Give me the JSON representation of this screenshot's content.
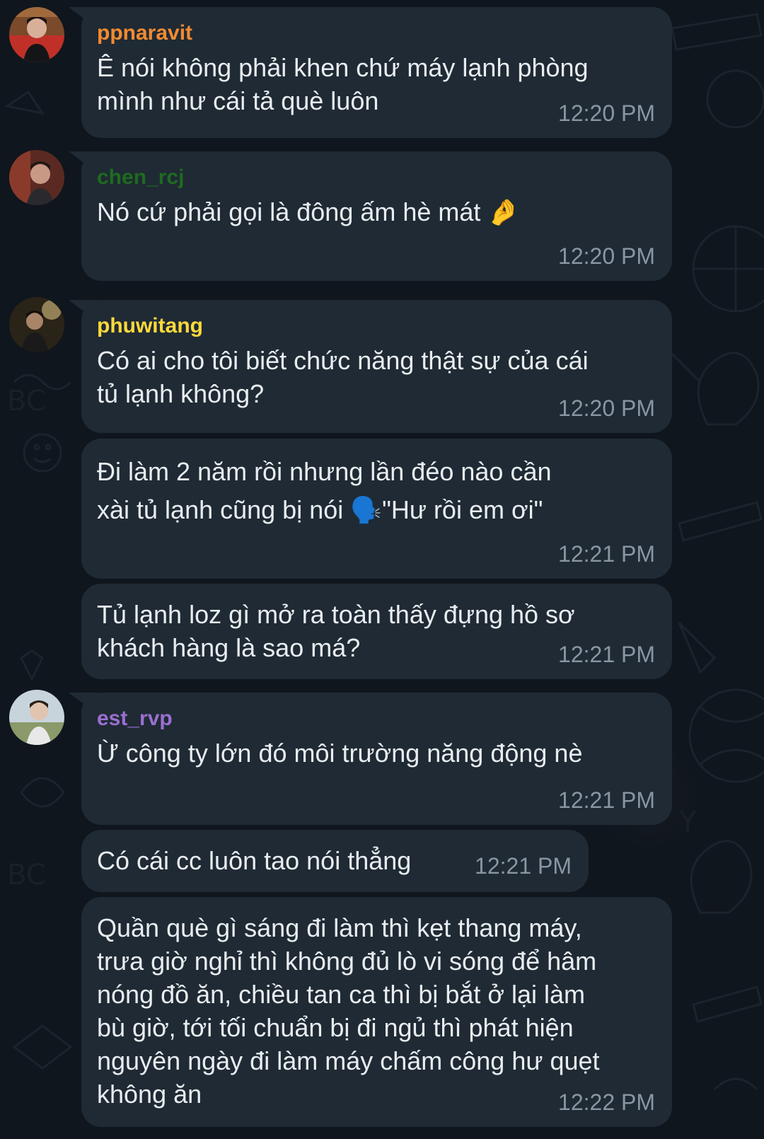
{
  "chat": {
    "messages": [
      {
        "sender": "ppnaravit",
        "sender_color": "#f28b30",
        "text": "Ê nói không phải khen chứ máy lạnh phòng\nmình như cái tả què luôn",
        "time": "12:20 PM"
      },
      {
        "sender": "chen_rcj",
        "sender_color": "#1e6b1f",
        "text": "Nó cứ phải gọi là đông ấm hè mát 🤌",
        "time": "12:20 PM"
      },
      {
        "sender": "phuwitang",
        "sender_color": "#ffd93b",
        "text": "Có ai cho tôi biết chức năng thật sự của cái\ntủ lạnh không?",
        "time": "12:20 PM"
      },
      {
        "text": "Đi làm 2 năm rồi nhưng lần đéo nào cần\nxài tủ lạnh cũng bị nói 🗣️\"Hư rồi em ơi\"",
        "time": "12:21 PM"
      },
      {
        "text": "Tủ lạnh loz gì mở ra toàn thấy đựng hồ sơ\nkhách hàng là sao má?",
        "time": "12:21 PM"
      },
      {
        "sender": "est_rvp",
        "sender_color": "#9b6fd1",
        "text": "Ừ công ty lớn đó môi trường năng động nè",
        "time": "12:21 PM"
      },
      {
        "text": "Có cái cc luôn tao nói thẳng",
        "time": "12:21 PM"
      },
      {
        "text": "Quần què gì sáng đi làm thì kẹt thang máy,\ntrưa giờ nghỉ thì không đủ lò vi sóng để hâm\nnóng đồ ăn, chiều tan ca thì bị bắt ở lại làm\nbù giờ, tới tối chuẩn bị đi ngủ thì phát hiện\nnguyên ngày đi làm máy chấm công hư quẹt\nkhông ăn",
        "time": "12:22 PM"
      }
    ]
  },
  "colors": {
    "background": "#10161d",
    "bubble": "#1f2a34",
    "text": "#e9edf0",
    "time": "#8a96a3"
  }
}
